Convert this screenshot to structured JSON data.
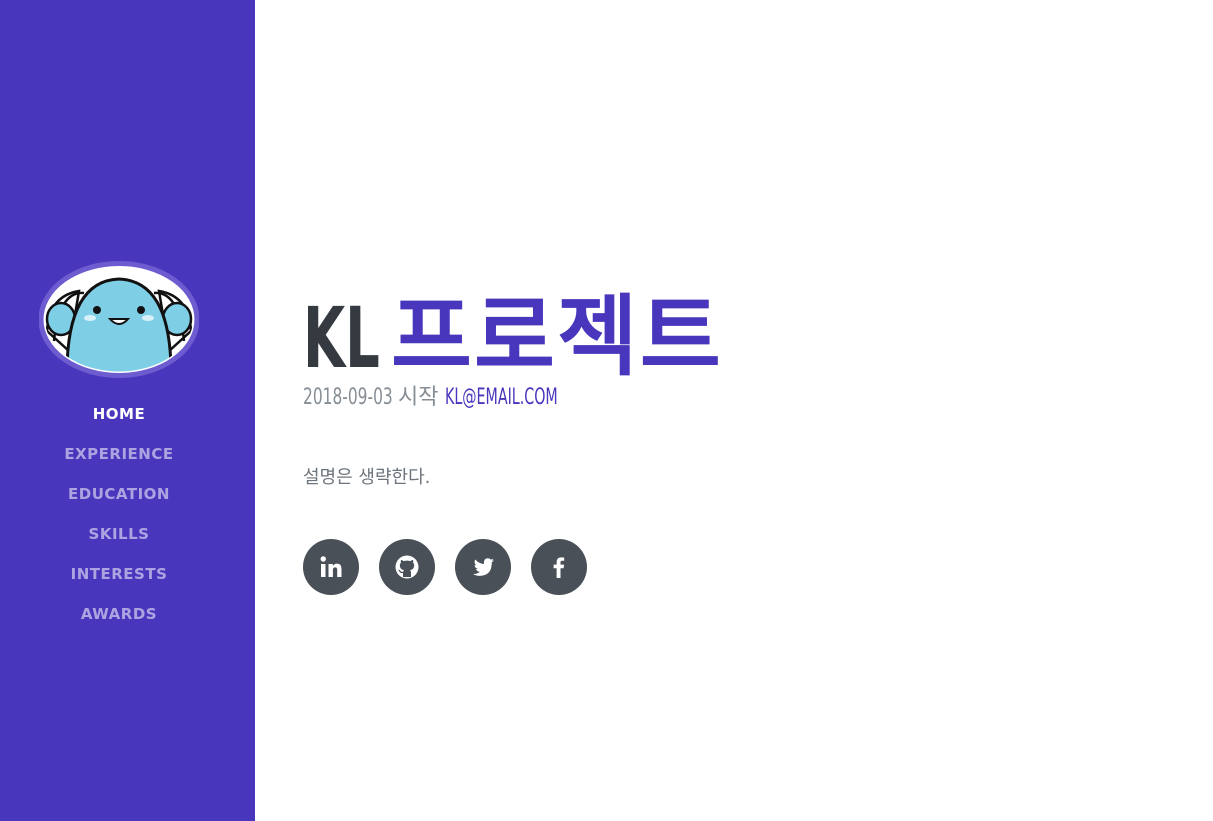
{
  "nav": {
    "items": [
      {
        "label": "HOME",
        "active": true
      },
      {
        "label": "EXPERIENCE",
        "active": false
      },
      {
        "label": "EDUCATION",
        "active": false
      },
      {
        "label": "SKILLS",
        "active": false
      },
      {
        "label": "INTERESTS",
        "active": false
      },
      {
        "label": "AWARDS",
        "active": false
      }
    ]
  },
  "header": {
    "name_first": "KL",
    "name_last": "프로젝트"
  },
  "subheading": {
    "date": "2018-09-03",
    "start_label": "시작",
    "email": "KL@EMAIL.COM"
  },
  "description": "설명은 생략한다.",
  "social": [
    {
      "icon": "linkedin-icon"
    },
    {
      "icon": "github-icon"
    },
    {
      "icon": "twitter-icon"
    },
    {
      "icon": "facebook-icon"
    }
  ],
  "colors": {
    "primary": "#4836bd",
    "heading": "#343a40",
    "muted": "#868e96",
    "social_bg": "#495057"
  }
}
